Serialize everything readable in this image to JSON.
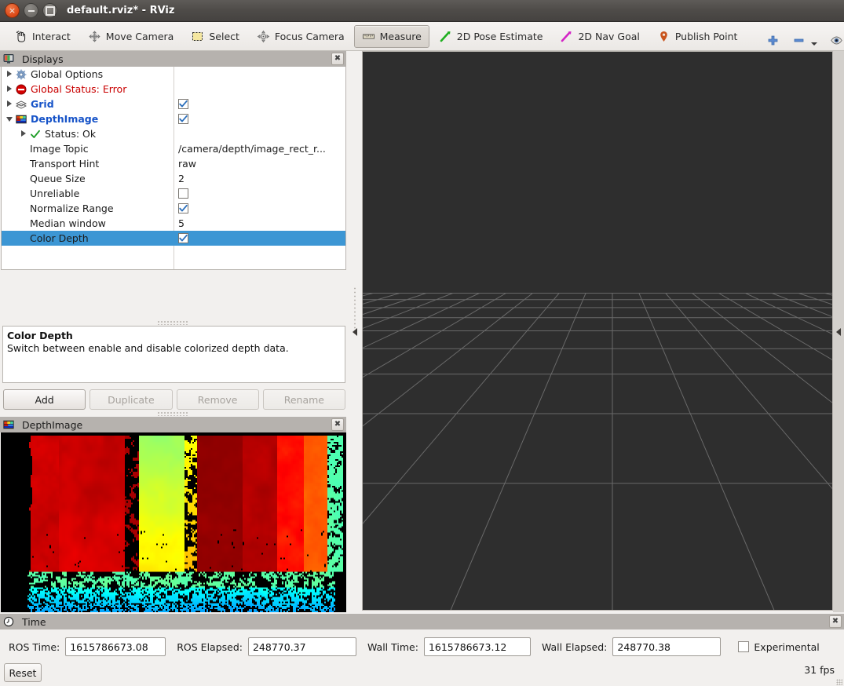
{
  "window": {
    "title": "default.rviz* - RViz",
    "buttons": {
      "close": "close",
      "minimize": "minimize",
      "maximize": "maximize"
    }
  },
  "toolbar": {
    "items": [
      {
        "label": "Interact",
        "icon": "hand-cursor-icon",
        "checked": false
      },
      {
        "label": "Move Camera",
        "icon": "move-camera-icon",
        "checked": false
      },
      {
        "label": "Select",
        "icon": "select-rect-icon",
        "checked": false
      },
      {
        "label": "Focus Camera",
        "icon": "focus-camera-icon",
        "checked": false
      },
      {
        "label": "Measure",
        "icon": "ruler-icon",
        "checked": true
      },
      {
        "label": "2D Pose Estimate",
        "icon": "green-arrow-icon",
        "checked": false
      },
      {
        "label": "2D Nav Goal",
        "icon": "magenta-arrow-icon",
        "checked": false
      },
      {
        "label": "Publish Point",
        "icon": "map-pin-icon",
        "checked": false
      }
    ],
    "extra": [
      {
        "icon": "plus-icon",
        "name": "add-tool-button"
      },
      {
        "icon": "minus-icon",
        "name": "remove-tool-button"
      },
      {
        "icon": "eye-icon",
        "name": "visibility-button"
      }
    ]
  },
  "displays": {
    "title": "Displays",
    "close_label": "✖",
    "tree": [
      {
        "label": "Global Options",
        "style": "plain",
        "arrow": "right",
        "indent": 0,
        "icon": "gear-icon",
        "value": "",
        "value_type": "none"
      },
      {
        "label": "Global Status: Error",
        "style": "red",
        "arrow": "right",
        "indent": 0,
        "icon": "error-icon",
        "value": "",
        "value_type": "none"
      },
      {
        "label": "Grid",
        "style": "blue",
        "arrow": "right",
        "indent": 0,
        "icon": "grid-icon",
        "value": "",
        "value_type": "checkbox-checked"
      },
      {
        "label": "DepthImage",
        "style": "blue",
        "arrow": "down",
        "indent": 0,
        "icon": "depthimage-icon",
        "value": "",
        "value_type": "checkbox-checked"
      },
      {
        "label": "Status: Ok",
        "style": "plain",
        "arrow": "right",
        "indent": 1,
        "icon": "check-icon",
        "value": "",
        "value_type": "none"
      },
      {
        "label": "Image Topic",
        "style": "plain",
        "arrow": "none",
        "indent": 2,
        "icon": "none",
        "value": "/camera/depth/image_rect_r...",
        "value_type": "text"
      },
      {
        "label": "Transport Hint",
        "style": "plain",
        "arrow": "none",
        "indent": 2,
        "icon": "none",
        "value": "raw",
        "value_type": "text"
      },
      {
        "label": "Queue Size",
        "style": "plain",
        "arrow": "none",
        "indent": 2,
        "icon": "none",
        "value": "2",
        "value_type": "text"
      },
      {
        "label": "Unreliable",
        "style": "plain",
        "arrow": "none",
        "indent": 2,
        "icon": "none",
        "value": "",
        "value_type": "checkbox-unchecked"
      },
      {
        "label": "Normalize Range",
        "style": "plain",
        "arrow": "none",
        "indent": 2,
        "icon": "none",
        "value": "",
        "value_type": "checkbox-checked"
      },
      {
        "label": "Median window",
        "style": "plain",
        "arrow": "none",
        "indent": 2,
        "icon": "none",
        "value": "5",
        "value_type": "text"
      },
      {
        "label": "Color Depth",
        "style": "plain",
        "arrow": "none",
        "indent": 2,
        "icon": "none",
        "value": "",
        "value_type": "checkbox-checked",
        "selected": true
      }
    ],
    "description": {
      "title": "Color Depth",
      "body": "Switch between enable and disable colorized depth data."
    },
    "buttons": [
      {
        "label": "Add",
        "enabled": true
      },
      {
        "label": "Duplicate",
        "enabled": false
      },
      {
        "label": "Remove",
        "enabled": false
      },
      {
        "label": "Rename",
        "enabled": false
      }
    ]
  },
  "depth_image_panel": {
    "title": "DepthImage",
    "close_label": "✖"
  },
  "view3d": {
    "background_color": "#2e2e2e",
    "grid_color": "#9a9a9a"
  },
  "time_panel": {
    "title": "Time",
    "close_label": "✖",
    "fields": [
      {
        "label": "ROS Time:",
        "value": "1615786673.08"
      },
      {
        "label": "ROS Elapsed:",
        "value": "248770.37"
      },
      {
        "label": "Wall Time:",
        "value": "1615786673.12"
      },
      {
        "label": "Wall Elapsed:",
        "value": "248770.38"
      }
    ],
    "experimental": {
      "label": "Experimental",
      "checked": false
    },
    "reset_label": "Reset",
    "fps": "31 fps"
  },
  "colors": {
    "titlebar": "#4e4b48",
    "selection": "#3c96d4",
    "panel_header": "#b6b2ae",
    "link_blue": "#1653c8",
    "error_red": "#c90000"
  }
}
